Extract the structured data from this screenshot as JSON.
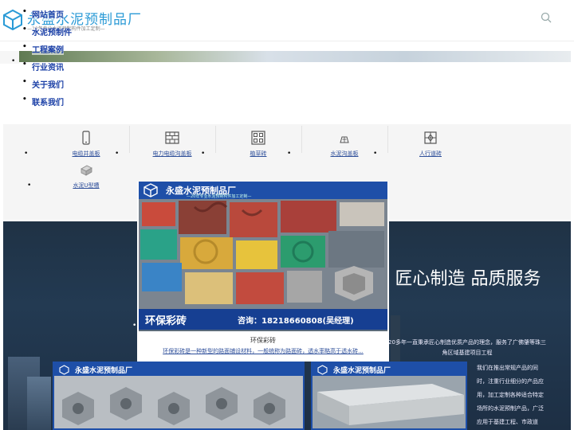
{
  "header": {
    "brand_name": "永盛水泥预制品厂",
    "brand_slogan": "—20年专业水泥预制构件加工定制—"
  },
  "nav": {
    "items": [
      {
        "label": "网站首页"
      },
      {
        "label": "水泥预制件"
      },
      {
        "label": "工程案例"
      },
      {
        "label": "行业资讯"
      },
      {
        "label": "关于我们"
      },
      {
        "label": "联系我们"
      }
    ]
  },
  "categories": [
    {
      "label": "电缆井盖板",
      "icon": "phone-icon"
    },
    {
      "label": "电力电缆沟盖板",
      "icon": "brick-wall-icon"
    },
    {
      "label": "植草砖",
      "icon": "grid-icon"
    },
    {
      "label": "水泥沟盖板",
      "icon": "building-icon"
    },
    {
      "label": "人行道砖",
      "icon": "tile-icon"
    },
    {
      "label": "水泥U型槽",
      "icon": "block-icon"
    }
  ],
  "featured": {
    "card_brand": "永盛水泥预制品厂",
    "card_brand_sub": "—20年专业水泥预制构件加工定制—",
    "footer_product": "环保彩砖",
    "footer_contact": "咨询：18218660808(吴经理)",
    "name": "环保彩砖",
    "description": "环保彩砖是一种新型的路面铺设材料，一般统称为路面砖，透水率略高于透水砖..."
  },
  "hero": {
    "title": "匠心制造 品质服务",
    "intro": "20多年一直秉承匠心制造优质产品的理念，服务了广佛肇等珠三角区域基建项目工程",
    "details": "我们在推出常规产品的同时，注重行业细分的产品应用，加工定制各种适合特定场所的水泥预制产品，广泛应用于基建工程、市政道路、人工草坪、运动场设施"
  },
  "thumbs": [
    {
      "brand": "永盛水泥预制品厂"
    },
    {
      "brand": "永盛水泥预制品厂"
    }
  ],
  "colors": {
    "brand_blue": "#2a9ad6",
    "nav_link": "#1a3fa6",
    "dark_section": "#233a52",
    "card_banner": "#1e4fa8"
  }
}
